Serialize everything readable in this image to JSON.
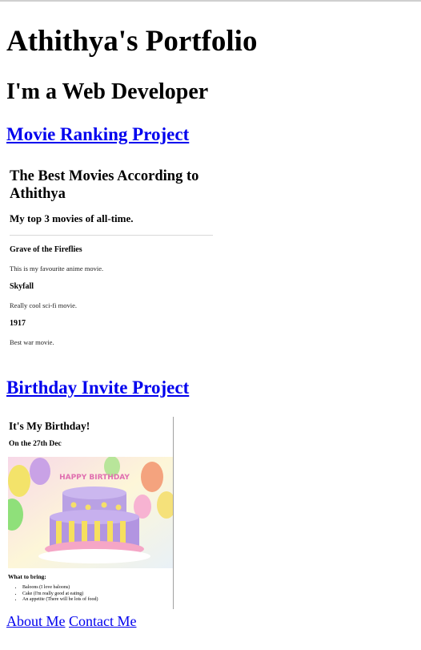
{
  "header": {
    "title": "Athithya's Portfolio",
    "subtitle": "I'm a Web Developer"
  },
  "projects": [
    {
      "label": "Movie Ranking Project"
    },
    {
      "label": "Birthday Invite Project"
    }
  ],
  "movie_page": {
    "title": "The Best Movies According to Athithya",
    "subtitle": "My top 3 movies of all-time.",
    "movies": [
      {
        "name": "Grave of the Fireflies",
        "desc": "This is my favourite anime movie."
      },
      {
        "name": "Skyfall",
        "desc": "Really cool sci-fi movie."
      },
      {
        "name": "1917",
        "desc": "Best war movie."
      }
    ]
  },
  "birthday_page": {
    "title": "It's My Birthday!",
    "date": "On the 27th Dec",
    "cake_text": "HAPPY BIRTHDAY",
    "bring_heading": "What to bring:",
    "items": [
      "Baloons (I love baloons)",
      "Cake (I'm really good at eating)",
      "An appetite (There will be lots of food)"
    ]
  },
  "footer": {
    "about": "About Me",
    "contact": "Contact Me"
  },
  "colors": {
    "link": "#0000ee",
    "divider": "#d8d8d8"
  }
}
